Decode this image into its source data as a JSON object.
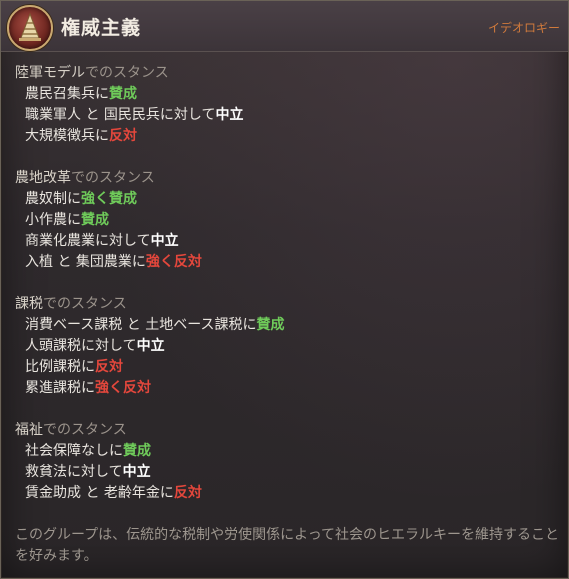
{
  "header": {
    "title": "権威主義",
    "category": "イデオロギー",
    "emblem_icon": "pyramid-icon"
  },
  "colors": {
    "approve": "#6fcb5a",
    "oppose": "#e4473c",
    "neutral": "#ffffff",
    "category": "#d07a3c"
  },
  "sections": [
    {
      "law": "陸軍モデル",
      "suffix": "でのスタンス",
      "rows": [
        {
          "items": "農民召集兵",
          "connector": "に",
          "stance": "賛成",
          "type": "approve",
          "trail": ""
        },
        {
          "items": "職業軍人 と 国民民兵",
          "connector": "に対して",
          "stance": "中立",
          "type": "neutral",
          "trail": ""
        },
        {
          "items": "大規模徴兵",
          "connector": "に",
          "stance": "反対",
          "type": "oppose",
          "trail": ""
        }
      ]
    },
    {
      "law": "農地改革",
      "suffix": "でのスタンス",
      "rows": [
        {
          "items": "農奴制",
          "connector": "に",
          "stance": "強く賛成",
          "type": "approve"
        },
        {
          "items": "小作農",
          "connector": "に",
          "stance": "賛成",
          "type": "approve"
        },
        {
          "items": "商業化農業",
          "connector": "に対して",
          "stance": "中立",
          "type": "neutral"
        },
        {
          "items": "入植 と 集団農業",
          "connector": "に",
          "stance": "強く反対",
          "type": "oppose"
        }
      ]
    },
    {
      "law": "課税",
      "suffix": "でのスタンス",
      "rows": [
        {
          "items": "消費ベース課税 と 土地ベース課税",
          "connector": "に",
          "stance": "賛成",
          "type": "approve"
        },
        {
          "items": "人頭課税",
          "connector": "に対して",
          "stance": "中立",
          "type": "neutral"
        },
        {
          "items": "比例課税",
          "connector": "に",
          "stance": "反対",
          "type": "oppose"
        },
        {
          "items": "累進課税",
          "connector": "に",
          "stance": "強く反対",
          "type": "oppose"
        }
      ]
    },
    {
      "law": "福祉",
      "suffix": "でのスタンス",
      "rows": [
        {
          "items": "社会保障なし",
          "connector": "に",
          "stance": "賛成",
          "type": "approve"
        },
        {
          "items": "救貧法",
          "connector": "に対して",
          "stance": "中立",
          "type": "neutral"
        },
        {
          "items": "賃金助成 と 老齢年金",
          "connector": "に",
          "stance": "反対",
          "type": "oppose"
        }
      ]
    }
  ],
  "description": "このグループは、伝統的な税制や労使関係によって社会のヒエラルキーを維持することを好みます。"
}
